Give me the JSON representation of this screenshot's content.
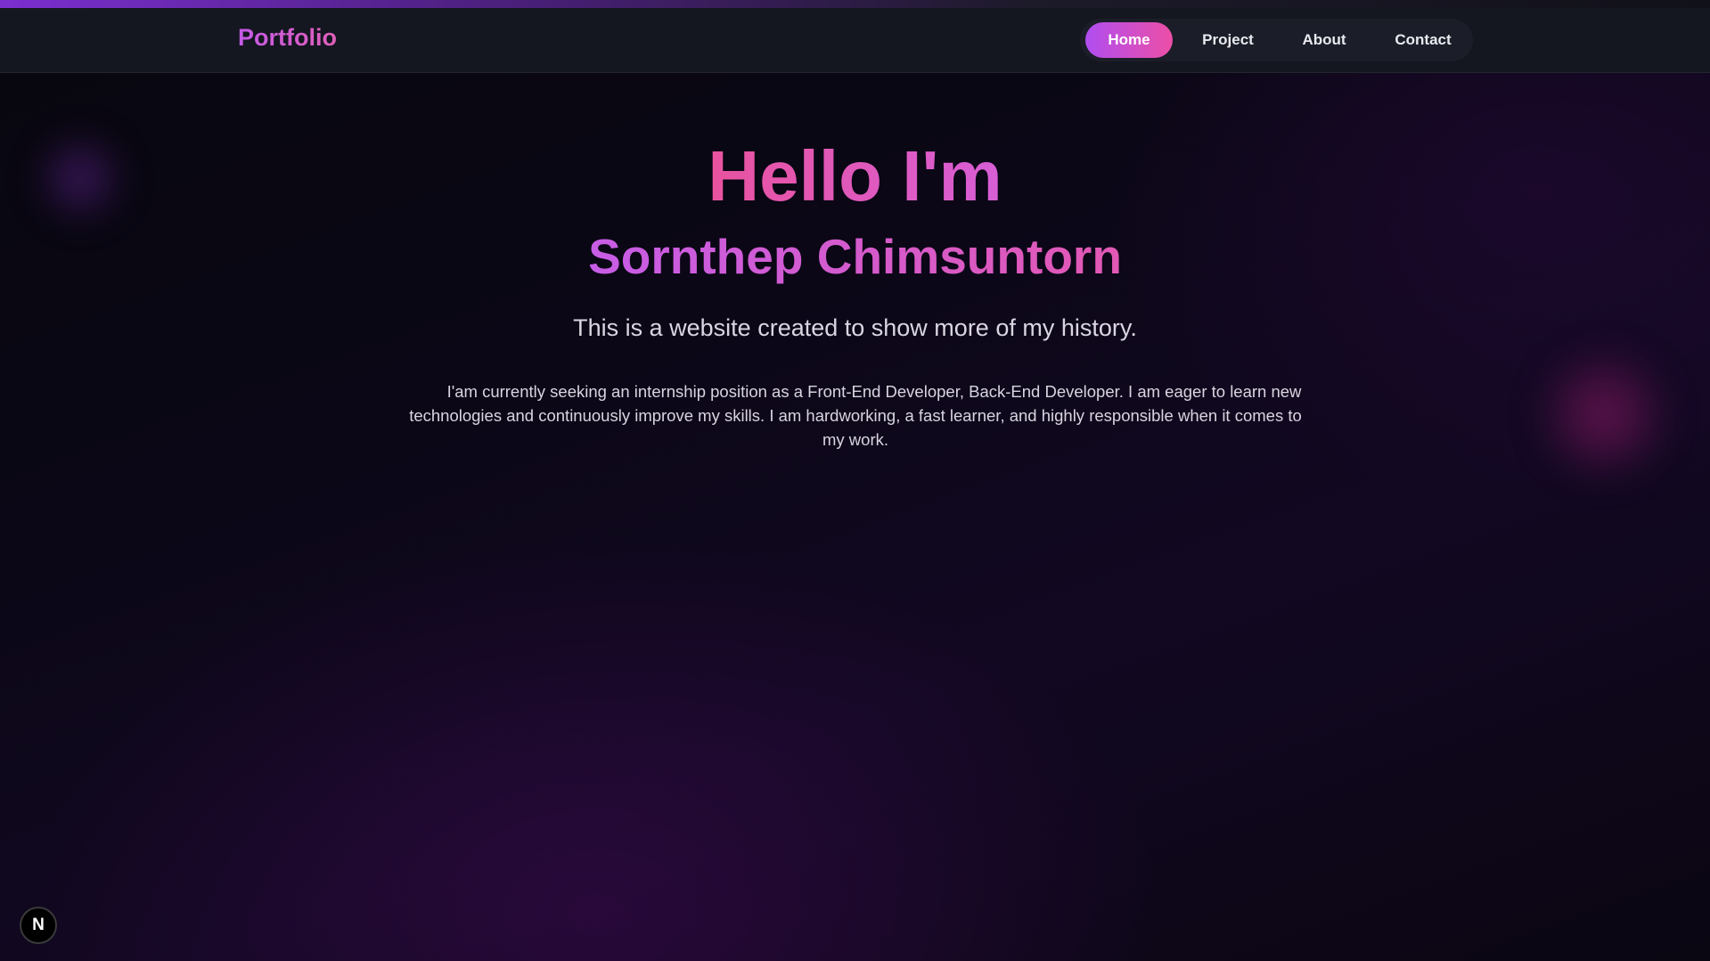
{
  "colors": {
    "accent_purple": "#b04ef0",
    "accent_pink": "#ec4fa6",
    "navbar_bg": "#141620",
    "page_bg": "#0b0716"
  },
  "header": {
    "brand": "Portfolio",
    "nav": [
      {
        "label": "Home",
        "active": true
      },
      {
        "label": "Project",
        "active": false
      },
      {
        "label": "About",
        "active": false
      },
      {
        "label": "Contact",
        "active": false
      }
    ]
  },
  "hero": {
    "greeting": "Hello I'm",
    "name": "Sornthep Chimsuntorn",
    "tagline": "This is a website created to show more of my history.",
    "intro": "I'am currently seeking an internship position as a Front-End Developer, Back-End Developer. I am eager to learn new technologies and continuously improve my skills. I am hardworking, a fast learner, and highly responsible when it comes to my work."
  },
  "dev_badge": {
    "label": "N",
    "icon": "nextjs-icon"
  }
}
